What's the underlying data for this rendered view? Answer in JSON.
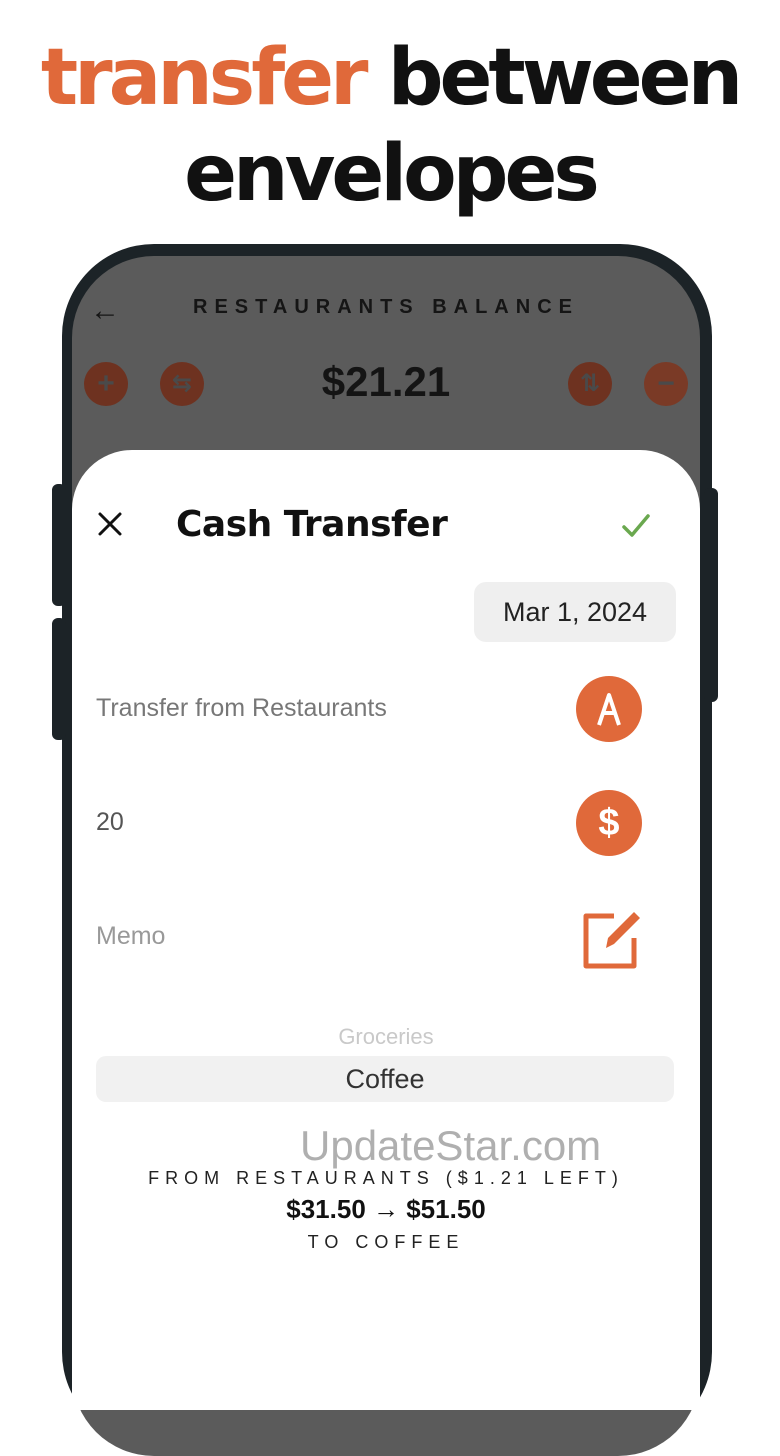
{
  "headline": {
    "accent": "transfer",
    "rest": "between",
    "line2": "envelopes"
  },
  "background_screen": {
    "title": "RESTAURANTS BALANCE",
    "balance": "$21.21",
    "icons": [
      "back-arrow-icon",
      "plus-icon",
      "swap-icon",
      "sort-icon",
      "minus-icon"
    ]
  },
  "sheet": {
    "title": "Cash Transfer",
    "date": "Mar 1, 2024",
    "from_label": "Transfer from Restaurants",
    "amount": "20",
    "memo_placeholder": "Memo",
    "picker": {
      "faded_option": "Groceries",
      "selected_option": "Coffee"
    },
    "summary": {
      "from": "FROM RESTAURANTS ($1.21 LEFT)",
      "amount": "$31.50 → $51.50",
      "to": "TO COFFEE"
    }
  },
  "watermark": "UpdateStar.com",
  "colors": {
    "accent": "#e0693a",
    "check": "#6aa84f",
    "overlay": "#5b5b5b"
  }
}
